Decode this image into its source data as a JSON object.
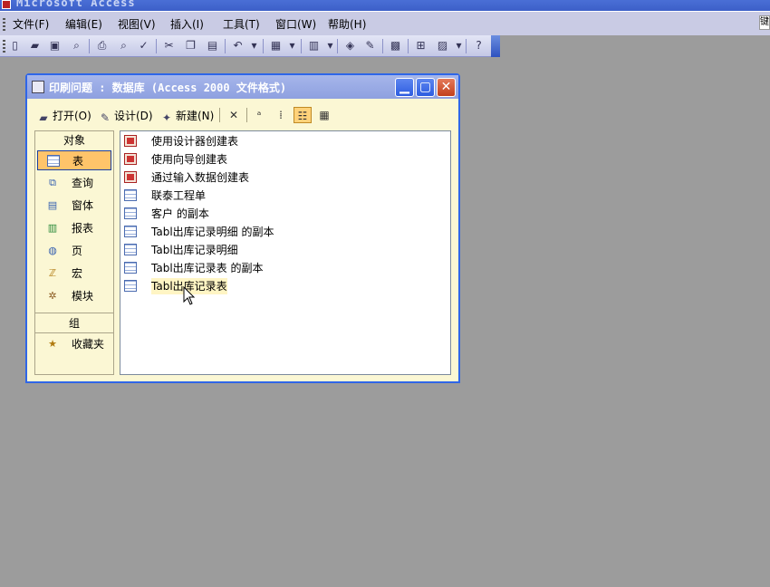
{
  "app": {
    "title": "Microsoft Access"
  },
  "menu": [
    "文件(F)",
    "编辑(E)",
    "视图(V)",
    "插入(I)",
    "工具(T)",
    "窗口(W)",
    "帮助(H)"
  ],
  "menu_right_text": "键",
  "db_window": {
    "title": "印刷问题 : 数据库 (Access 2000 文件格式)",
    "toolbar": {
      "open": "打开(O)",
      "design": "设计(D)",
      "new": "新建(N)"
    }
  },
  "objects": {
    "header": "对象",
    "items": [
      "表",
      "查询",
      "窗体",
      "报表",
      "页",
      "宏",
      "模块"
    ],
    "selected": "表",
    "group_header": "组",
    "group_items": [
      "收藏夹"
    ]
  },
  "list_items": [
    {
      "label": "使用设计器创建表",
      "icon": "wizard-icon"
    },
    {
      "label": "使用向导创建表",
      "icon": "wizard-icon"
    },
    {
      "label": "通过输入数据创建表",
      "icon": "wizard-icon"
    },
    {
      "label": "联泰工程单",
      "icon": "table-icon"
    },
    {
      "label": "客户 的副本",
      "icon": "table-icon"
    },
    {
      "label": "Tabl出库记录明细 的副本",
      "icon": "table-icon"
    },
    {
      "label": "Tabl出库记录明细",
      "icon": "table-icon"
    },
    {
      "label": "Tabl出库记录表 的副本",
      "icon": "table-icon"
    },
    {
      "label": "Tabl出库记录表",
      "icon": "table-icon"
    }
  ],
  "hovered_item": "Tabl出库记录表",
  "colors": {
    "desktop": "#9c9c9c",
    "window_border": "#2f66e8",
    "pane_bg": "#fbf7d4",
    "selected_bg": "#ffc46a",
    "close_button": "#c2401c"
  }
}
